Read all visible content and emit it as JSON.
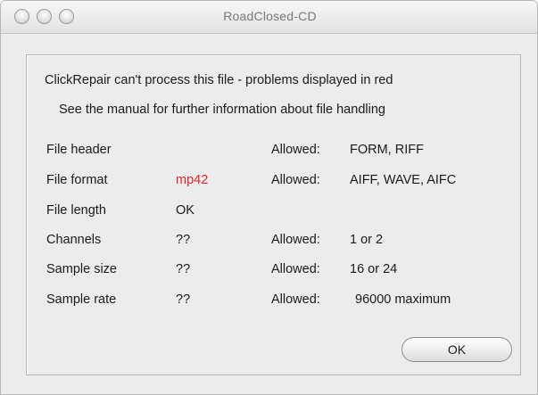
{
  "window": {
    "title": "RoadClosed-CD"
  },
  "dialog": {
    "message_line1": "ClickRepair can't process this file - problems displayed in red",
    "message_line2": "See the manual for further information about file handling",
    "rows": [
      {
        "label": "File header",
        "value": "",
        "value_status": "normal",
        "allowed_label": "Allowed:",
        "allowed_value": "FORM, RIFF"
      },
      {
        "label": "File format",
        "value": "mp42",
        "value_status": "error",
        "allowed_label": "Allowed:",
        "allowed_value": "AIFF, WAVE, AIFC"
      },
      {
        "label": "File length",
        "value": "OK",
        "value_status": "normal",
        "allowed_label": "",
        "allowed_value": ""
      },
      {
        "label": "Channels",
        "value": "??",
        "value_status": "normal",
        "allowed_label": "Allowed:",
        "allowed_value": "1 or 2"
      },
      {
        "label": "Sample size",
        "value": "??",
        "value_status": "normal",
        "allowed_label": "Allowed:",
        "allowed_value": "16 or 24"
      },
      {
        "label": "Sample rate",
        "value": "??",
        "value_status": "normal",
        "allowed_label": "Allowed:",
        "allowed_value": "96000 maximum"
      }
    ],
    "ok_label": "OK"
  },
  "colors": {
    "error_text": "#e0262a",
    "window_background": "#ececec"
  },
  "icons": {
    "close": "close-traffic-light-icon",
    "minimize": "minimize-traffic-light-icon",
    "zoom": "zoom-traffic-light-icon"
  }
}
